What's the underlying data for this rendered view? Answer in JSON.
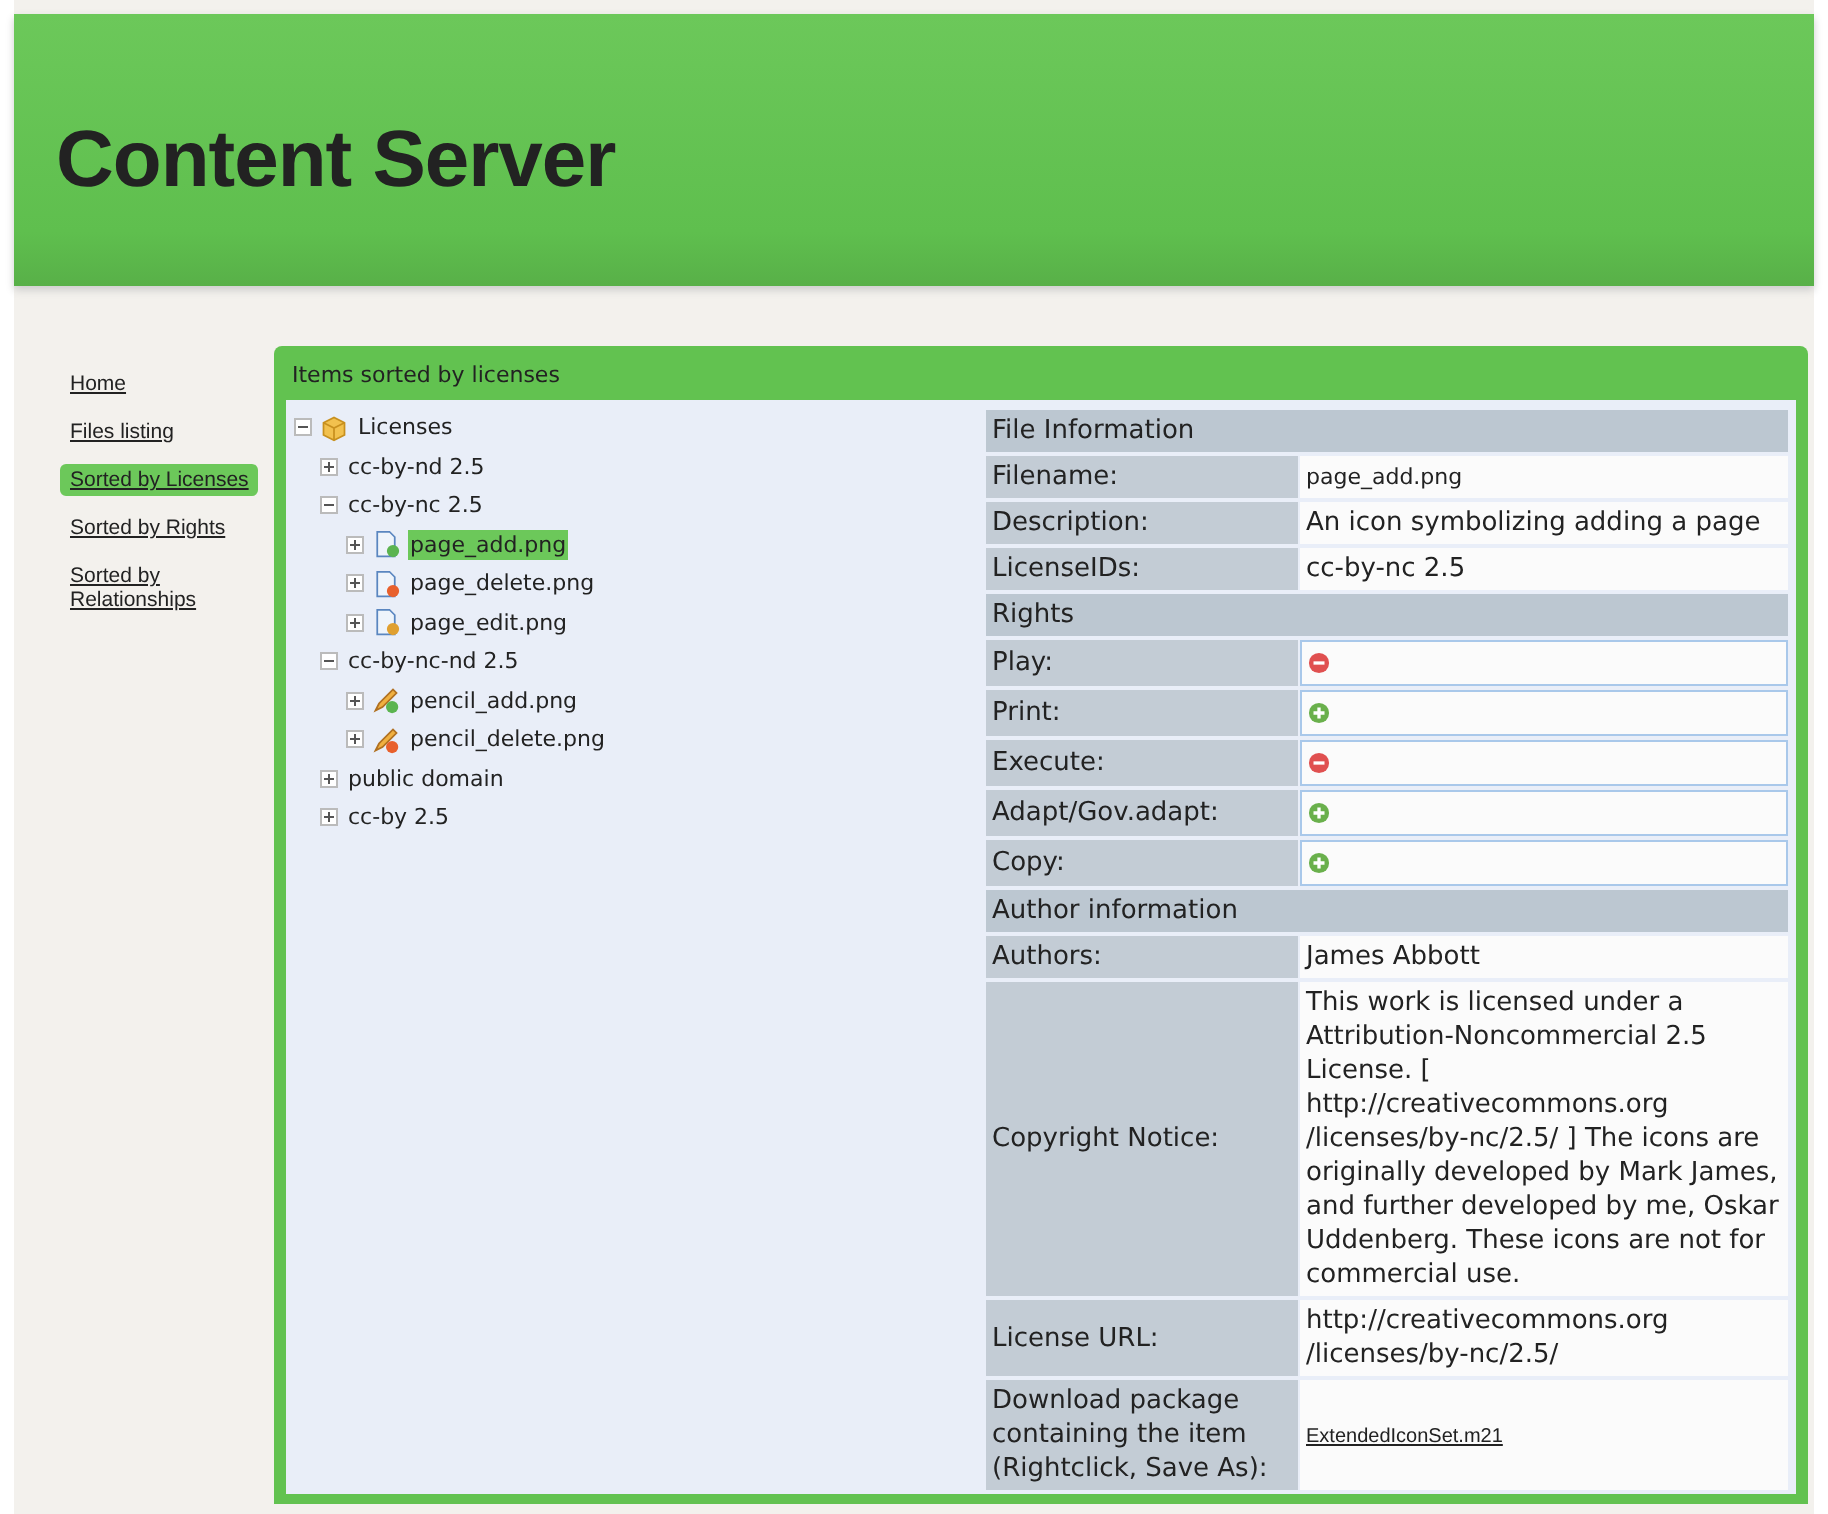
{
  "header": {
    "title": "Content Server"
  },
  "sidebar": {
    "items": [
      {
        "label": "Home",
        "selected": false
      },
      {
        "label": "Files listing",
        "selected": false
      },
      {
        "label": "Sorted by Licenses",
        "selected": true
      },
      {
        "label": "Sorted by Rights",
        "selected": false
      },
      {
        "label": "Sorted by Relationships",
        "selected": false
      }
    ]
  },
  "panel": {
    "title": "Items sorted by licenses",
    "tree": [
      {
        "label": "Licenses",
        "kind": "box",
        "expanded": true,
        "selected": false,
        "children": [
          {
            "label": "cc-by-nd 2.5",
            "expanded": false,
            "selected": false
          },
          {
            "label": "cc-by-nc 2.5",
            "expanded": true,
            "selected": false,
            "children": [
              {
                "label": "page_add.png",
                "kind": "page-add",
                "expanded": false,
                "selected": true
              },
              {
                "label": "page_delete.png",
                "kind": "page-delete",
                "expanded": false,
                "selected": false
              },
              {
                "label": "page_edit.png",
                "kind": "page-edit",
                "expanded": false,
                "selected": false
              }
            ]
          },
          {
            "label": "cc-by-nc-nd 2.5",
            "expanded": true,
            "selected": false,
            "children": [
              {
                "label": "pencil_add.png",
                "kind": "pencil-add",
                "expanded": false,
                "selected": false
              },
              {
                "label": "pencil_delete.png",
                "kind": "pencil-delete",
                "expanded": false,
                "selected": false
              }
            ]
          },
          {
            "label": "public domain",
            "expanded": false,
            "selected": false
          },
          {
            "label": "cc-by 2.5",
            "expanded": false,
            "selected": false
          }
        ]
      }
    ],
    "details": [
      {
        "title": "File Information",
        "rows": [
          {
            "kind": "small",
            "label": "Filename:",
            "value": "page_add.png"
          },
          {
            "kind": "text",
            "label": "Description:",
            "value": "An icon symbolizing adding a page"
          },
          {
            "kind": "text",
            "label": "LicenseIDs:",
            "value": "cc-by-nc 2.5"
          }
        ]
      },
      {
        "title": "Rights",
        "rows": [
          {
            "kind": "permission",
            "label": "Play:",
            "allowed": false
          },
          {
            "kind": "permission",
            "label": "Print:",
            "allowed": true
          },
          {
            "kind": "permission",
            "label": "Execute:",
            "allowed": false
          },
          {
            "kind": "permission",
            "label": "Adapt/Gov.adapt:",
            "allowed": true
          },
          {
            "kind": "permission",
            "label": "Copy:",
            "allowed": true
          }
        ]
      },
      {
        "title": "Author information",
        "rows": [
          {
            "kind": "text",
            "label": "Authors:",
            "value": "James Abbott"
          },
          {
            "kind": "text",
            "label": "Copyright Notice:",
            "value": "This work is licensed under a Attribution-Noncommercial 2.5 License. [ http://creativecommons.org /licenses/by-nc/2.5/ ] The icons are originally developed by Mark James, and further developed by me, Oskar Uddenberg. These icons are not for commercial use."
          },
          {
            "kind": "text",
            "label": "License URL:",
            "value": "http://creativecommons.org /licenses/by-nc/2.5/"
          },
          {
            "kind": "link",
            "label": "Download package containing the item (Rightclick, Save As):",
            "value": "ExtendedIconSet.m21"
          }
        ]
      }
    ]
  }
}
